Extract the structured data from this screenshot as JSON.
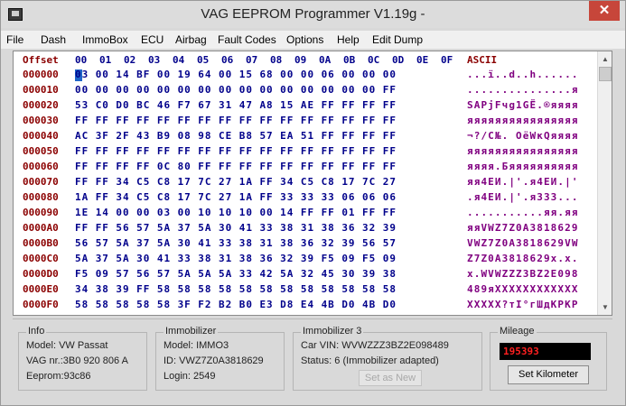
{
  "window": {
    "title": "VAG EEPROM Programmer  V1.19g -",
    "close_glyph": "✕"
  },
  "menu": [
    "File",
    "Dash",
    "ImmoBox",
    "ECU",
    "Airbag",
    "Fault Codes",
    "Options",
    "Help",
    "Edit Dump"
  ],
  "hex": {
    "header_offset": "Offset",
    "header_cols": [
      "00",
      "01",
      "02",
      "03",
      "04",
      "05",
      "06",
      "07",
      "08",
      "09",
      "0A",
      "0B",
      "0C",
      "0D",
      "0E",
      "0F"
    ],
    "header_ascii": "ASCII",
    "rows": [
      {
        "offset": "000000",
        "hex": "03 00 14 BF 00 19 64 00 15 68 00 00 06 00 00 00",
        "ascii": "...ї..d..h......"
      },
      {
        "offset": "000010",
        "hex": "00 00 00 00 00 00 00 00 00 00 00 00 00 00 00 FF",
        "ascii": "...............я"
      },
      {
        "offset": "000020",
        "hex": "53 C0 D0 BC 46 F7 67 31 47 A8 15 AE FF FF FF FF",
        "ascii": "SАРјFчg1GЁ.®яяяя"
      },
      {
        "offset": "000030",
        "hex": "FF FF FF FF FF FF FF FF FF FF FF FF FF FF FF FF",
        "ascii": "яяяяяяяяяяяяяяяя"
      },
      {
        "offset": "000040",
        "hex": "AC 3F 2F 43 B9 08 98 CE B8 57 EA 51 FF FF FF FF",
        "ascii": "¬?/C№. ОёWкQяяяя"
      },
      {
        "offset": "000050",
        "hex": "FF FF FF FF FF FF FF FF FF FF FF FF FF FF FF FF",
        "ascii": "яяяяяяяяяяяяяяяя"
      },
      {
        "offset": "000060",
        "hex": "FF FF FF FF 0C 80 FF FF FF FF FF FF FF FF FF FF",
        "ascii": "яяяя.Бяяяяяяяяяя"
      },
      {
        "offset": "000070",
        "hex": "FF FF 34 C5 C8 17 7C 27 1A FF 34 C5 C8 17 7C 27",
        "ascii": "яя4ЕИ.|'.я4ЕИ.|'"
      },
      {
        "offset": "000080",
        "hex": "1A FF 34 C5 C8 17 7C 27 1A FF 33 33 33 06 06 06",
        "ascii": ".я4ЕИ.|'.я333..."
      },
      {
        "offset": "000090",
        "hex": "1E 14 00 00 03 00 10 10 10 00 14 FF FF 01 FF FF",
        "ascii": "...........яя.яя"
      },
      {
        "offset": "0000A0",
        "hex": "FF FF 56 57 5A 37 5A 30 41 33 38 31 38 36 32 39",
        "ascii": "яяVWZ7Z0A3818629"
      },
      {
        "offset": "0000B0",
        "hex": "56 57 5A 37 5A 30 41 33 38 31 38 36 32 39 56 57",
        "ascii": "VWZ7Z0A3818629VW"
      },
      {
        "offset": "0000C0",
        "hex": "5A 37 5A 30 41 33 38 31 38 36 32 39 F5 09 F5 09",
        "ascii": "Z7Z0A3818629x.x."
      },
      {
        "offset": "0000D0",
        "hex": "F5 09 57 56 57 5A 5A 5A 33 42 5A 32 45 30 39 38",
        "ascii": "x.WVWZZZ3BZ2E098"
      },
      {
        "offset": "0000E0",
        "hex": "34 38 39 FF 58 58 58 58 58 58 58 58 58 58 58 58",
        "ascii": "489яXXXXXXXXXXXX"
      },
      {
        "offset": "0000F0",
        "hex": "58 58 58 58 58 3F F2 B2 B0 E3 D8 E4 4B D0 4B D0",
        "ascii": "XXXXX?тІ°гШдKРKР"
      }
    ]
  },
  "info": {
    "title": "Info",
    "model": "Model:  VW Passat",
    "vag_nr": "VAG nr.:3B0 920 806 A",
    "eeprom": "Eeprom:93c86"
  },
  "immobilizer": {
    "title": "Immobilizer",
    "model": "Model:  IMMO3",
    "id": "ID: VWZ7Z0A3818629",
    "login": "Login: 2549"
  },
  "immobilizer3": {
    "title": "Immobilizer 3",
    "car_vin": "Car VIN:  WVWZZZ3BZ2E098489",
    "status": "Status: 6 (Immobilizer adapted)",
    "set_as_new": "Set as New"
  },
  "mileage": {
    "title": "Mileage",
    "value": "195393",
    "set_button": "Set Kilometer"
  }
}
